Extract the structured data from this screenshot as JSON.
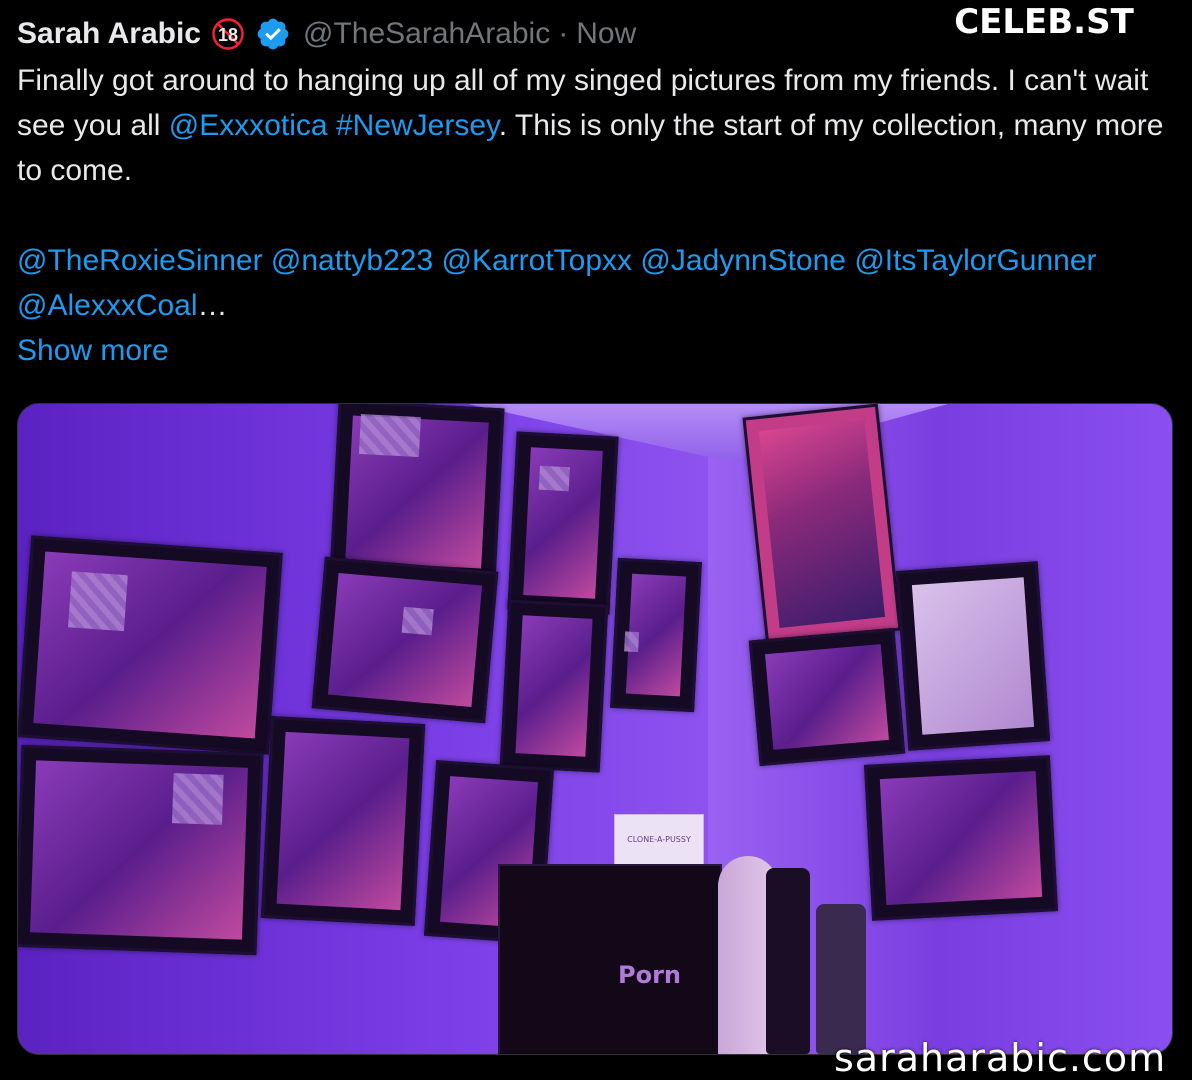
{
  "watermark_top": "CELEB.ST",
  "watermark_bottom": "saraharabic.com",
  "tweet": {
    "display_name": "Sarah Arabic",
    "age_badge": "18",
    "handle": "@TheSarahArabic",
    "separator": "·",
    "time": "Now",
    "text": {
      "line1_a": "Finally got around to hanging up all of my singed pictures from my friends. I can't wait see you all ",
      "mention_exxxotica": "@Exxxotica",
      "space": " ",
      "hashtag_newjersey": "#NewJersey",
      "line1_b": ".   This is only the start of my collection, many more to come.",
      "mentions": [
        "@TheRoxieSinner",
        "@nattyb223",
        "@KarrotTopxx",
        "@JadynnStone",
        "@ItsTaylorGunner",
        "@AlexxxCoal"
      ],
      "ellipsis": "…"
    },
    "show_more": "Show more"
  },
  "media": {
    "cabinet_logo": "Porn",
    "box_label": "CLONE-A-PUSSY"
  },
  "colors": {
    "background": "#000000",
    "text": "#e7e9ea",
    "muted": "#71767b",
    "link": "#1d9bf0",
    "verified": "#1d9bf0",
    "age_badge": "#f4212e"
  }
}
